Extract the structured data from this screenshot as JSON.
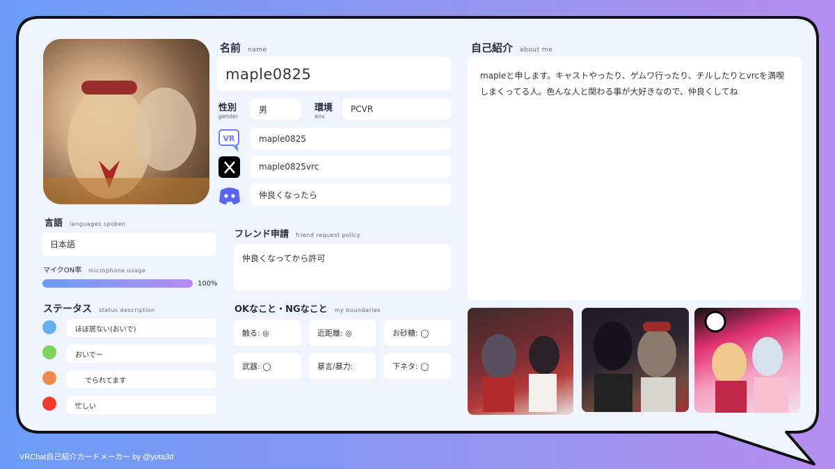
{
  "card": {
    "name": {
      "label": "名前",
      "sub": "name",
      "value": "maple0825"
    },
    "gender": {
      "label": "性別",
      "sub": "gender",
      "value": "男"
    },
    "env": {
      "label": "環境",
      "sub": "env",
      "value": "PCVR"
    },
    "socials": [
      {
        "icon": "vrchat-icon",
        "value": "maple0825"
      },
      {
        "icon": "x-icon",
        "value": "maple0825vrc"
      },
      {
        "icon": "discord-icon",
        "value": "仲良くなったら"
      }
    ],
    "languages": {
      "label": "言語",
      "sub": "languages spoken",
      "value": "日本語"
    },
    "mic": {
      "label": "マイクON率",
      "sub": "microphone usage",
      "percent_text": "100%",
      "level": 1.0
    },
    "status": {
      "label": "ステータス",
      "sub": "status description",
      "items": [
        {
          "color": "#6aaef0",
          "text": "ほぼ居ない(おいで)"
        },
        {
          "color": "#7ed35a",
          "text": "おいでー"
        },
        {
          "color": "#f08a4a",
          "text": "でられてます"
        },
        {
          "color": "#ef3b2c",
          "text": "忙しい"
        }
      ]
    },
    "friend": {
      "label": "フレンド申請",
      "sub": "friend request policy",
      "value": "仲良くなってから許可"
    },
    "boundaries": {
      "label": "OKなこと・NGなこと",
      "sub": "my boundaries",
      "items": [
        "触る: ◎",
        "近距離: ◎",
        "お砂糖: ◯",
        "武器: ◯",
        "暴言/暴力:",
        "下ネタ: ◯"
      ]
    },
    "about": {
      "label": "自己紹介",
      "sub": "about me",
      "text": "mapleと申します。キャストやったり、ゲムワ行ったり、チルしたりとvrcを満喫しまくってる人。色んな人と関わる事が大好きなので、仲良くしてね"
    }
  },
  "footer": "VRChat自己紹介カードメーカー by @yota3d",
  "colors": {
    "accent_gradient": [
      "#6a9cf5",
      "#b58ef0"
    ],
    "bubble_bg": "#eef3fc"
  }
}
